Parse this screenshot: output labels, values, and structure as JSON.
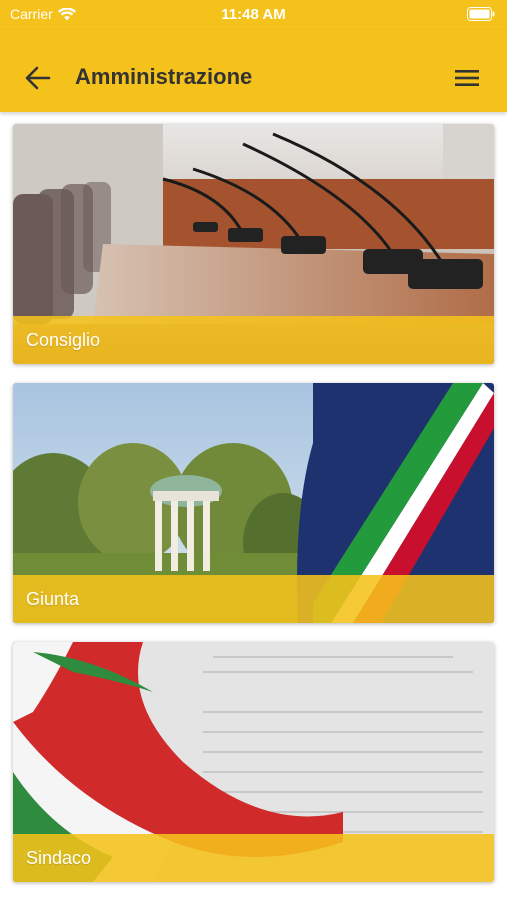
{
  "status_bar": {
    "carrier": "Carrier",
    "time": "11:48 AM"
  },
  "header": {
    "title": "Amministrazione"
  },
  "cards": [
    {
      "label": "Consiglio"
    },
    {
      "label": "Giunta"
    },
    {
      "label": "Sindaco"
    }
  ],
  "colors": {
    "accent": "#f5c21b",
    "title_text": "#333333"
  },
  "icons": [
    "wifi-icon",
    "battery-icon",
    "back-arrow-icon",
    "hamburger-menu-icon"
  ]
}
